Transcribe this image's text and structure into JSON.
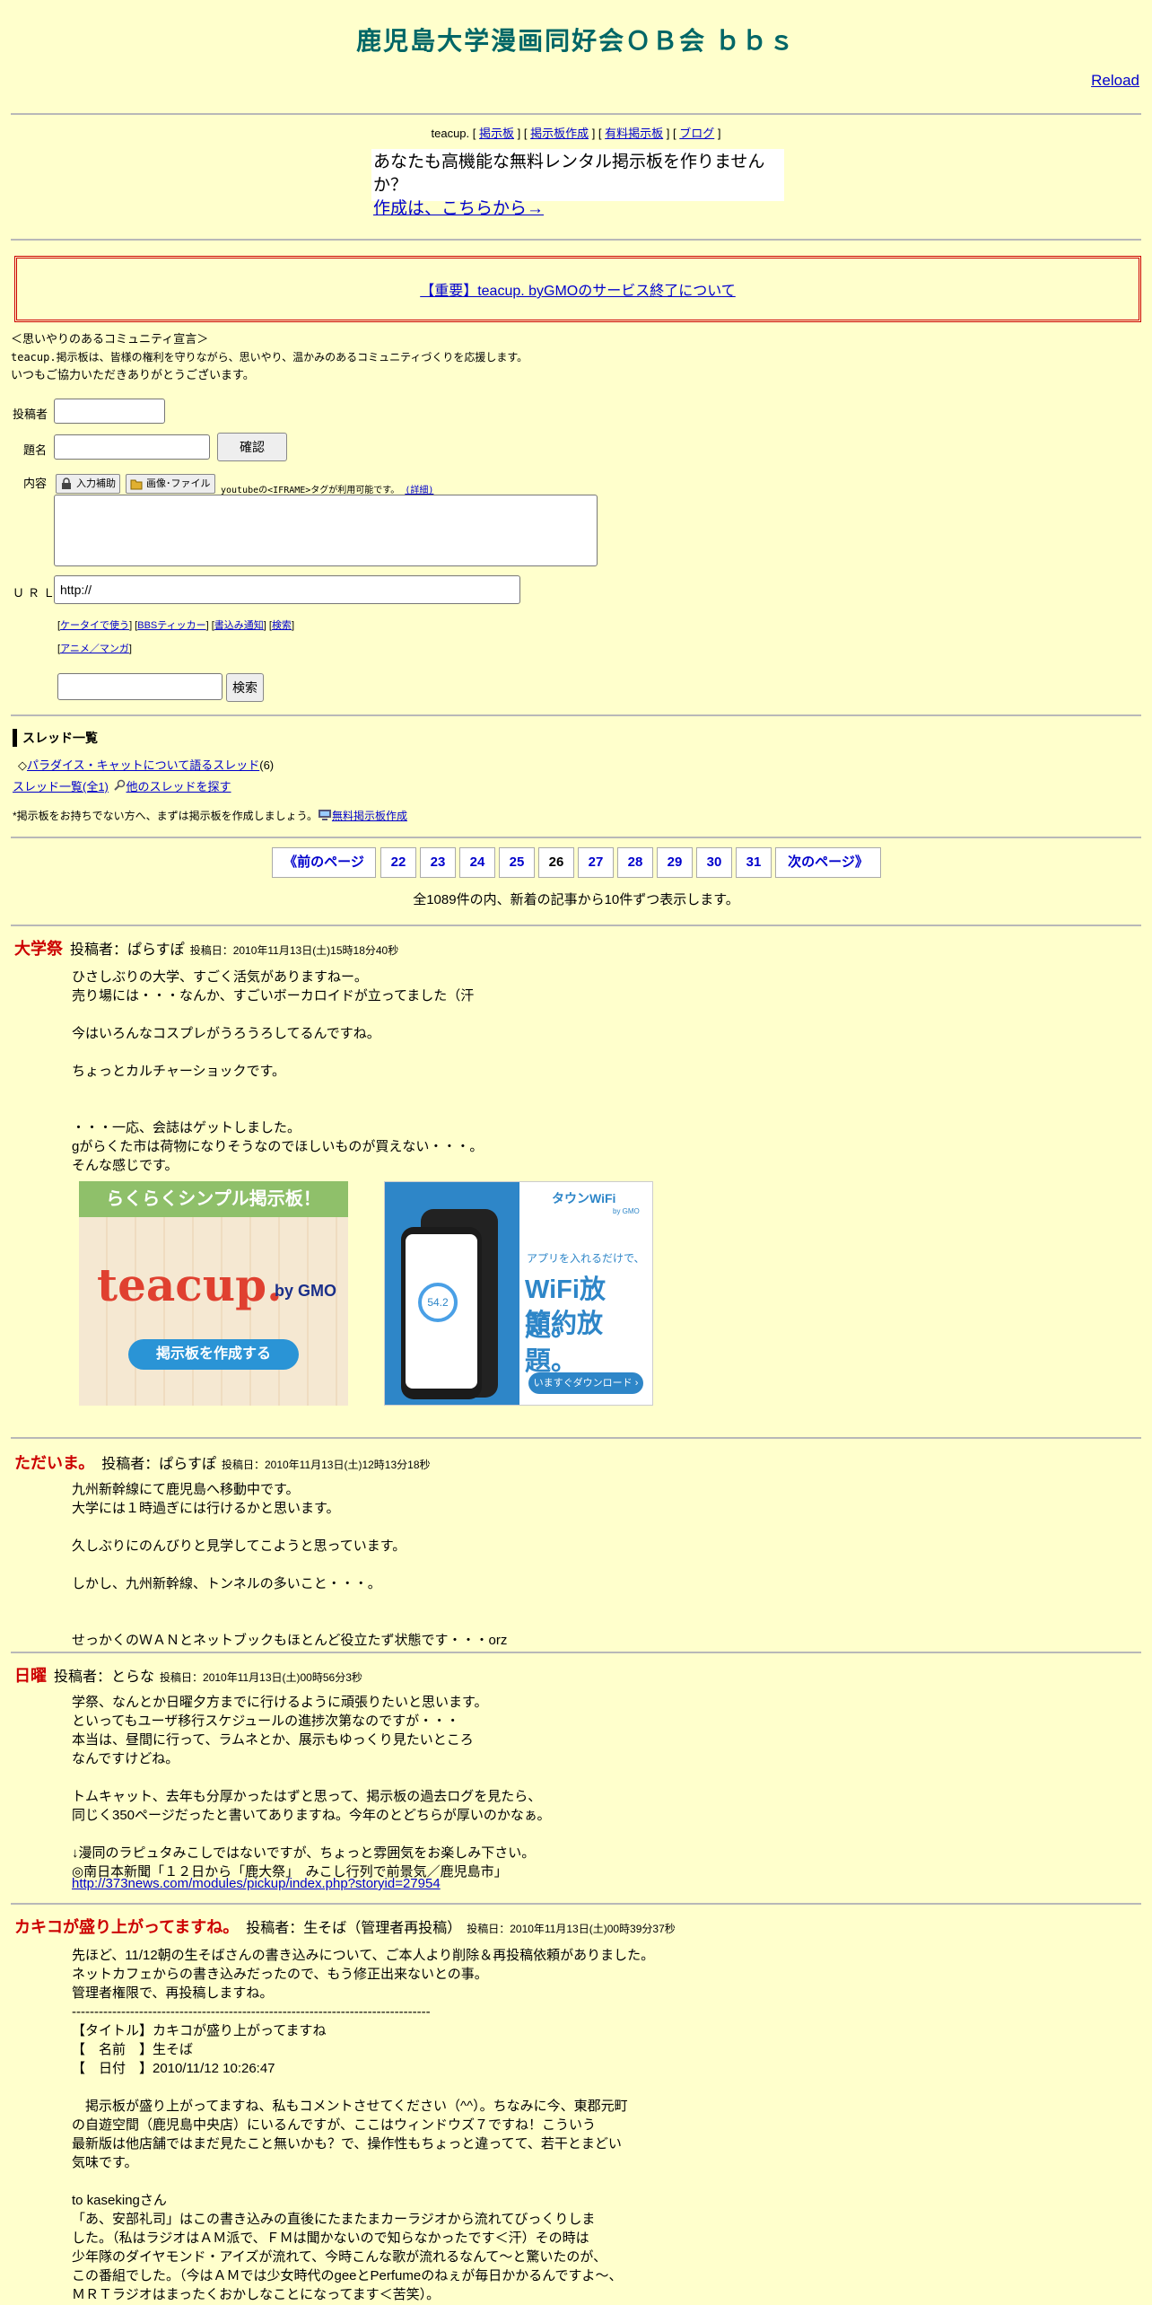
{
  "header": {
    "title": "鹿児島大学漫画同好会ＯＢ会 ｂｂｓ",
    "reload": "Reload"
  },
  "topnav": {
    "brand": "teacup.",
    "links": [
      "掲示板",
      "掲示板作成",
      "有料掲示板",
      "ブログ"
    ]
  },
  "promo": {
    "line1": "あなたも高機能な無料レンタル掲示板を作りませんか？",
    "link": "作成は、こちらから→"
  },
  "notice": {
    "link": "【重要】teacup. byGMOのサービス終了について"
  },
  "declaration": {
    "line1": "＜思いやりのあるコミュニティ宣言＞",
    "line2": "teacup.掲示板は、皆様の権利を守りながら、思いやり、温かみのあるコミュニティづくりを応援します。",
    "line3": "いつもご協力いただきありがとうございます。"
  },
  "form": {
    "author_label": "投稿者",
    "subject_label": "題名",
    "confirm_button": "確認",
    "content_label": "内容",
    "input_help_button": "入力補助",
    "image_file_button": "画像･ファイル",
    "youtube_note": "youtubeの<IFRAME>タグが利用可能です。",
    "youtube_detail": "(詳細)",
    "url_label": "ＵＲＬ",
    "url_value": "http://",
    "links_row1": [
      "ケータイで使う",
      "BBSティッカー",
      "書込み通知",
      "検索"
    ],
    "links_row2": [
      "アニメ／マンガ"
    ],
    "search_button": "検索"
  },
  "threads": {
    "heading": "スレッド一覧",
    "item_prefix": "◇",
    "item_label": "パラダイス・キャットについて語るスレッド",
    "item_count": "(6)",
    "all_link": "スレッド一覧(全1)",
    "other_link": "他のスレッドを探す",
    "footer_note": "*掲示板をお持ちでない方へ、まずは掲示板を作成しましょう。",
    "footer_link": "無料掲示板作成"
  },
  "pager": {
    "prev": "《前のページ",
    "pages": [
      "22",
      "23",
      "24",
      "25",
      "26",
      "27",
      "28",
      "29",
      "30",
      "31"
    ],
    "current": "26",
    "next": "次のページ》",
    "summary": "全1089件の内、新着の記事から10件ずつ表示します。"
  },
  "posts": [
    {
      "title": "大学祭",
      "author": "投稿者：ぱらすぽ",
      "date": "投稿日：2010年11月13日(土)15時18分40秒",
      "body": "ひさしぶりの大学、すごく活気がありますねー。\n売り場には・・・なんか、すごいボーカロイドが立ってました（汗\n\n今はいろんなコスプレがうろうろしてるんですね。\n\nちょっとカルチャーショックです。\n\n\n・・・一応、会誌はゲットしました。\ngがらくた市は荷物になりそうなのでほしいものが買えない・・・。\nそんな感じです。"
    },
    {
      "title": "ただいま。",
      "author": "投稿者：ぱらすぽ",
      "date": "投稿日：2010年11月13日(土)12時13分18秒",
      "body": "九州新幹線にて鹿児島へ移動中です。\n大学には１時過ぎには行けるかと思います。\n\n久しぶりにのんびりと見学してこようと思っています。\n\nしかし、九州新幹線、トンネルの多いこと・・・。\n\n\nせっかくのＷＡＮとネットブックもほとんど役立たず状態です・・・orz"
    },
    {
      "title": "日曜",
      "author": "投稿者：とらな",
      "date": "投稿日：2010年11月13日(土)00時56分3秒",
      "body": "学祭、なんとか日曜夕方までに行けるように頑張りたいと思います。\nといってもユーザ移行スケジュールの進捗次第なのですが・・・\n本当は、昼間に行って、ラムネとか、展示もゆっくり見たいところ\nなんですけどね。\n\nトムキャット、去年も分厚かったはずと思って、掲示板の過去ログを見たら、\n同じく350ページだったと書いてありますね。今年のとどちらが厚いのかなぁ。\n\n↓漫同のラピュタみこしではないですが、ちょっと雰囲気をお楽しみ下さい。\n◎南日本新聞「１２日から「鹿大祭」　みこし行列で前景気／鹿児島市」",
      "link": "http://373news.com/modules/pickup/index.php?storyid=27954"
    },
    {
      "title": "カキコが盛り上がってますね。",
      "author": "投稿者：生そば（管理者再投稿）",
      "date": "投稿日：2010年11月13日(土)00時39分37秒",
      "body": "先ほど、11/12朝の生そばさんの書き込みについて、ご本人より削除＆再投稿依頼がありました。\nネットカフェからの書き込みだったので、もう修正出来ないとの事。\n管理者権限で、再投稿しますね。\n--------------------------------------------------------------------------------\n【タイトル】カキコが盛り上がってますね\n【　名前　】生そば\n【　日付　】2010/11/12 10:26:47\n\n　掲示板が盛り上がってますね、私もコメントさせてください（^^）。ちなみに今、東郡元町\nの自遊空間（鹿児島中央店）にいるんですが、ここはウィンドウズ７ですね！こういう\n最新版は他店舗ではまだ見たこと無いかも？で、操作性もちょっと違ってて、若干とまどい\n気味です。\n\nto kasekingさん\n「あ、安部礼司」はこの書き込みの直後にたまたまカーラジオから流れてびっくりしま\nした。（私はラジオはＡＭ派で、ＦＭは聞かないので知らなかったです＜汗）その時は\n少年隊のダイヤモンド・アイズが流れて、今時こんな歌が流れるなんて～と驚いたのが、\nこの番組でした。（今はＡＭでは少女時代のgeeとPerfumeのねぇが毎日かかるんですよ～、\nＭＲＴラジオはまったくおかしなことになってます＜苦笑）。"
    }
  ],
  "ads": {
    "teacup": {
      "top": "らくらくシンプル掲示板！",
      "logo": "teacup.",
      "by": "by GMO",
      "cta": "掲示板を作成する"
    },
    "wifi": {
      "brand": "タウンWiFi",
      "sub": "by GMO",
      "line1": "アプリを入れるだけで、",
      "line2": "WiFi放題。",
      "line3": "節約放題。",
      "cta": "いますぐダウンロード ›",
      "gauge": "54.2"
    }
  },
  "colors": {
    "background": "#ffffcc",
    "title": "#006666",
    "post_title": "#cc0000",
    "link": "#0000cc"
  }
}
